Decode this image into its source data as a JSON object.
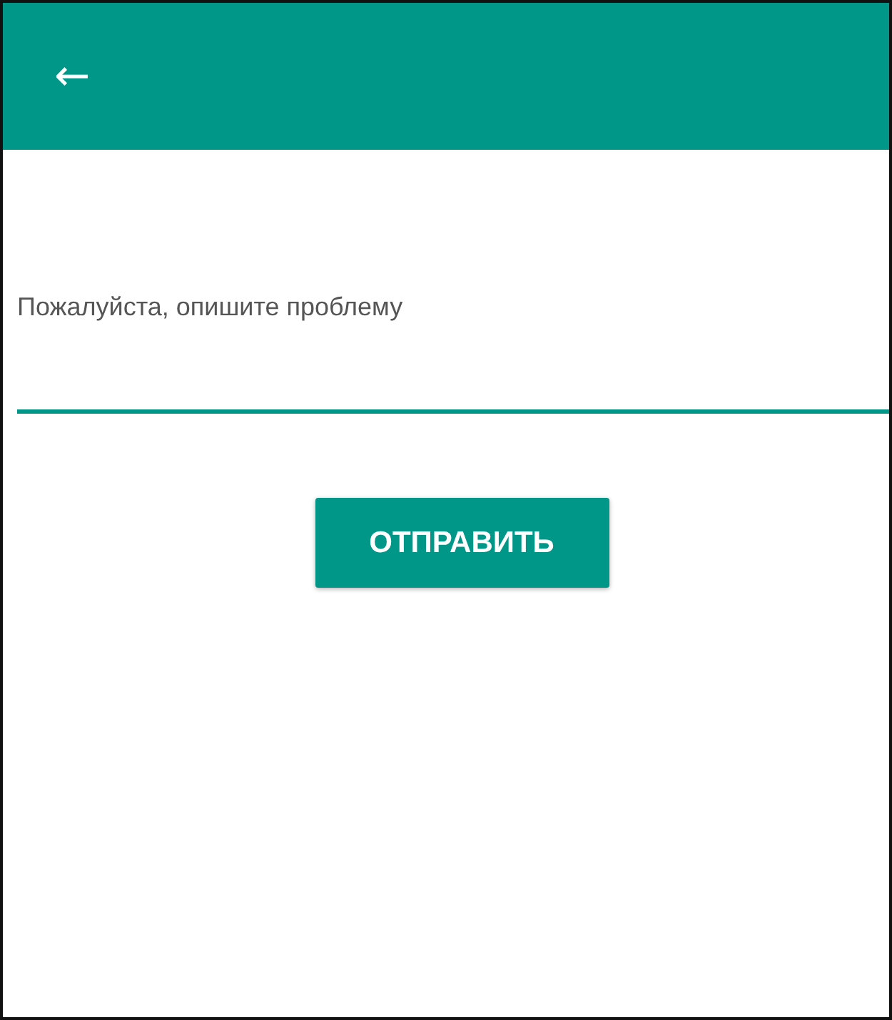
{
  "app_bar": {
    "back_icon": "←"
  },
  "problem_field": {
    "placeholder": "Пожалуйста, опишите проблему"
  },
  "submit_button": {
    "label": "ОТПРАВИТЬ"
  }
}
